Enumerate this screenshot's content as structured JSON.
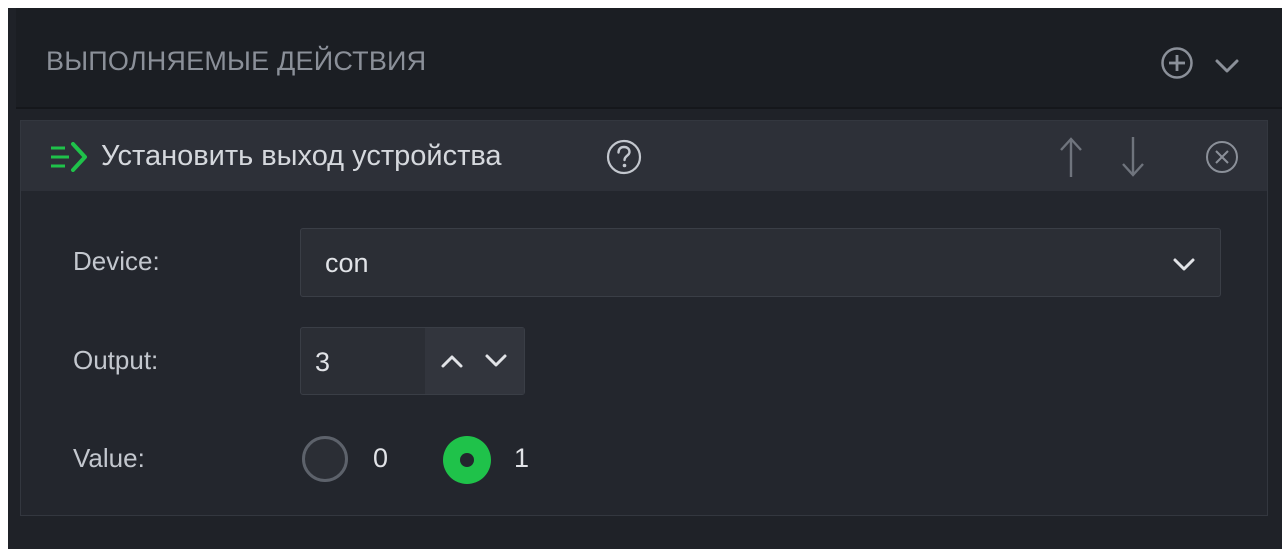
{
  "section": {
    "title": "ВЫПОЛНЯЕМЫЕ ДЕЙСТВИЯ",
    "add_icon": "plus-circle-icon",
    "collapse_icon": "chevron-down-icon"
  },
  "action": {
    "icon": "set-output-arrow-icon",
    "title": "Установить выход устройства",
    "help_icon": "question-circle-icon",
    "move_up_icon": "arrow-up-icon",
    "move_down_icon": "arrow-down-icon",
    "remove_icon": "close-circle-icon"
  },
  "form": {
    "device": {
      "label": "Device:",
      "value": "con"
    },
    "output": {
      "label": "Output:",
      "value": "3"
    },
    "value": {
      "label": "Value:",
      "options": [
        "0",
        "1"
      ],
      "selected": "1"
    }
  },
  "colors": {
    "accent": "#1fc24a",
    "background": "#1f2228",
    "panel": "#23262d",
    "panel_header": "#2d3038"
  }
}
